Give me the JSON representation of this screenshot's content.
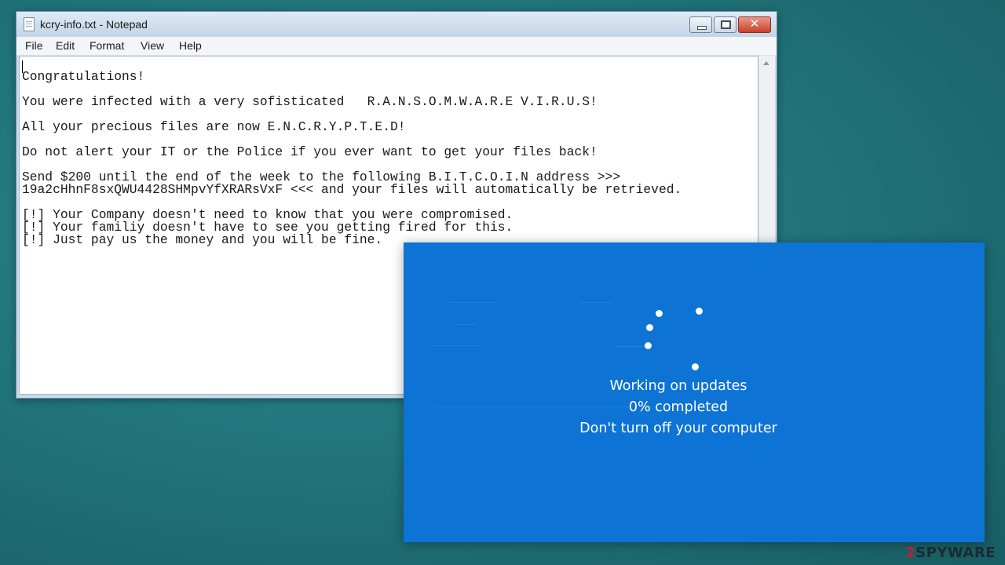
{
  "notepad": {
    "title": "kcry-info.txt - Notepad",
    "menu": [
      "File",
      "Edit",
      "Format",
      "View",
      "Help"
    ],
    "content": "Congratulations!\n\nYou were infected with a very sofisticated   R.A.N.S.O.M.W.A.R.E V.I.R.U.S!\n\nAll your precious files are now E.N.C.R.Y.P.T.E.D!\n\nDo not alert your IT or the Police if you ever want to get your files back!\n\nSend $200 until the end of the week to the following B.I.T.C.O.I.N address >>>\n19a2cHhnF8sxQWU4428SHMpvYfXRARsVxF <<< and your files will automatically be retrieved.\n\n[!] Your Company doesn't need to know that you were compromised.\n[!] Your familiy doesn't have to see you getting fired for this.\n[!] Just pay us the money and you will be fine.",
    "window_buttons": [
      "minimize-icon",
      "maximize-icon",
      "close-icon"
    ]
  },
  "update_screen": {
    "line1": "Working on updates",
    "line2": "0% completed",
    "line3": "Don't turn off your computer",
    "background_color": "#0d73d4",
    "spinner_icon": "loading-dots-icon"
  },
  "watermark": {
    "prefix": "2",
    "text": "SPYWARE"
  }
}
